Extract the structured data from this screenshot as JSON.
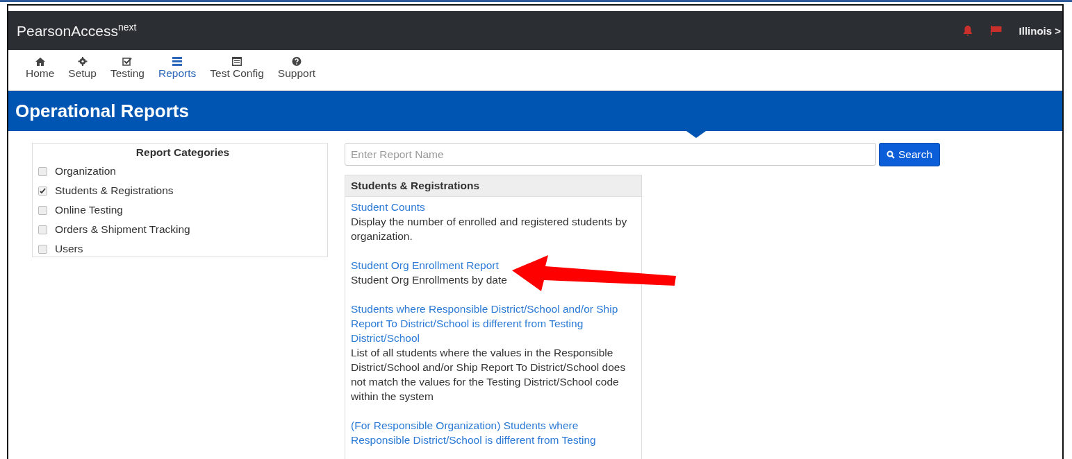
{
  "header": {
    "brand": "PearsonAccess",
    "brand_sup": "next",
    "state_menu": "Illinois >"
  },
  "nav": [
    {
      "label": "Home",
      "selected": false
    },
    {
      "label": "Setup",
      "selected": false
    },
    {
      "label": "Testing",
      "selected": false
    },
    {
      "label": "Reports",
      "selected": true
    },
    {
      "label": "Test Config",
      "selected": false
    },
    {
      "label": "Support",
      "selected": false
    }
  ],
  "page_title": "Operational Reports",
  "categories": {
    "title": "Report Categories",
    "items": [
      {
        "label": "Organization",
        "checked": false
      },
      {
        "label": "Students & Registrations",
        "checked": true
      },
      {
        "label": "Online Testing",
        "checked": false
      },
      {
        "label": "Orders & Shipment Tracking",
        "checked": false
      },
      {
        "label": "Users",
        "checked": false
      }
    ]
  },
  "search": {
    "placeholder": "Enter Report Name",
    "button": "Search"
  },
  "results": {
    "title": "Students & Registrations",
    "reports": [
      {
        "name": "Student Counts",
        "description": "Display the number of enrolled and registered students by organization."
      },
      {
        "name": "Student Org Enrollment Report",
        "description": "Student Org Enrollments by date"
      },
      {
        "name": "Students where Responsible District/School and/or Ship Report To District/School is different from Testing District/School",
        "description": "List of all students where the values in the Responsible District/School and/or Ship Report To District/School does not match the values for the Testing District/School code within the system"
      },
      {
        "name": "(For Responsible Organization) Students where Responsible District/School is different from Testing"
      }
    ]
  }
}
